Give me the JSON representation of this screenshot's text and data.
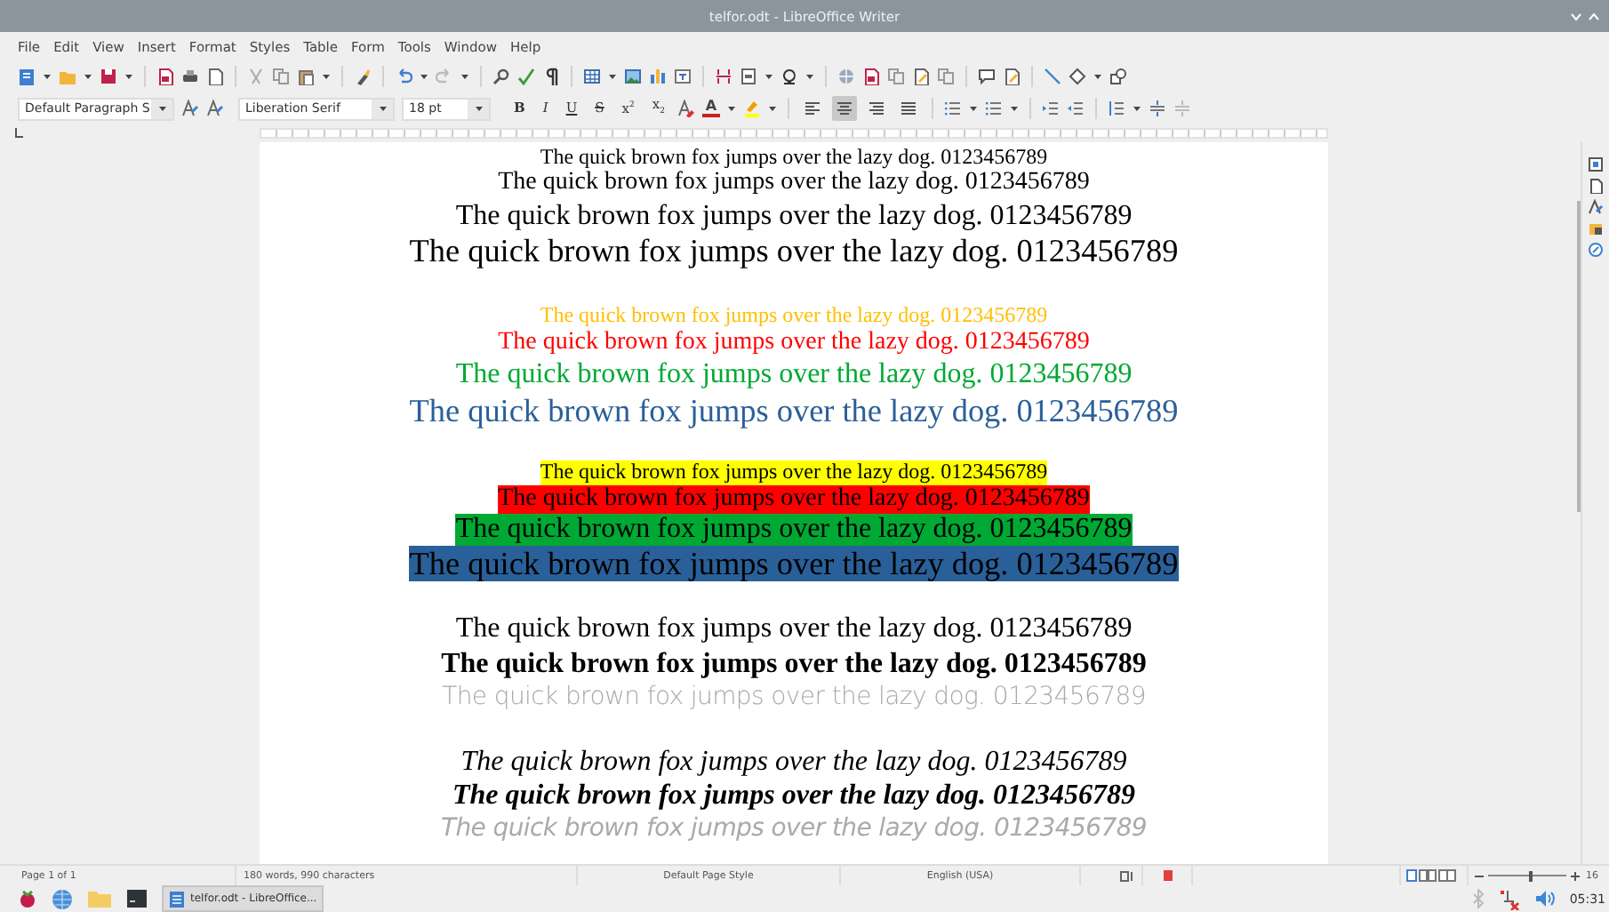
{
  "window": {
    "title": "telfor.odt - LibreOffice Writer"
  },
  "menu": [
    "File",
    "Edit",
    "View",
    "Insert",
    "Format",
    "Styles",
    "Table",
    "Form",
    "Tools",
    "Window",
    "Help"
  ],
  "formatting": {
    "paragraph_style": "Default Paragraph S",
    "font_name": "Liberation Serif",
    "font_size": "18 pt",
    "text_buttons": [
      {
        "label": "B",
        "kind": "bold"
      },
      {
        "label": "I",
        "kind": "italic"
      },
      {
        "label": "U",
        "kind": "underline"
      },
      {
        "label": "S",
        "kind": "strike"
      },
      {
        "label": "x$^{2}$",
        "kind": "plain"
      },
      {
        "label": "x$_{2}$",
        "kind": "plain"
      }
    ],
    "color_buttons": [
      {
        "label": "A",
        "color": "#c9211e"
      }
    ],
    "alignment": [
      {
        "selected": false
      },
      {
        "selected": true
      },
      {
        "selected": false
      },
      {
        "selected": false
      }
    ]
  },
  "document": {
    "groups": [
      {
        "kind": "sizes",
        "lines": [
          {
            "text": "The quick brown fox jumps over the lazy dog. 0123456789"
          },
          {
            "text": "The quick brown fox jumps over the lazy dog. 0123456789"
          },
          {
            "text": "The quick brown fox jumps over the lazy dog. 0123456789"
          },
          {
            "text": "The quick brown fox jumps over the lazy dog. 0123456789"
          }
        ]
      },
      {
        "kind": "colors",
        "lines": [
          {
            "text": "The quick brown fox jumps over the lazy dog. 0123456789",
            "color": "#ffbf00"
          },
          {
            "text": "The quick brown fox jumps over the lazy dog. 0123456789",
            "color": "#ff0000"
          },
          {
            "text": "The quick brown fox jumps over the lazy dog. 0123456789",
            "color": "#00a933"
          },
          {
            "text": "The quick brown fox jumps over the lazy dog. 0123456789",
            "color": "#2a6099"
          }
        ]
      },
      {
        "kind": "highlights",
        "lines": [
          {
            "text": "The quick brown fox jumps over the lazy dog. 0123456789",
            "color": "#ffff00"
          },
          {
            "text": "The quick brown fox jumps over the lazy dog. 0123456789",
            "color": "#ff0000"
          },
          {
            "text": "The quick brown fox jumps over the lazy dog. 0123456789",
            "color": "#00a933"
          },
          {
            "text": "The quick brown fox jumps over the lazy dog. 0123456789",
            "color": "#2a6099"
          }
        ]
      },
      {
        "kind": "styles",
        "lines": [
          {
            "text": "The quick brown fox jumps over the lazy dog. 0123456789",
            "kind": "regular"
          },
          {
            "text": "The quick brown fox jumps over the lazy dog. 0123456789",
            "kind": "bold"
          },
          {
            "text": "The quick brown fox jumps over the lazy dog. 0123456789",
            "kind": "light"
          }
        ]
      },
      {
        "kind": "styles",
        "lines": [
          {
            "text": "The quick brown fox jumps over the lazy dog. 0123456789",
            "kind": "italic"
          },
          {
            "text": "The quick brown fox jumps over the lazy dog. 0123456789",
            "kind": "bold-italic"
          },
          {
            "text": "The quick brown fox jumps over the lazy dog. 0123456789",
            "kind": "light-italic"
          }
        ]
      }
    ]
  },
  "status_bar": {
    "page": "Page 1 of 1",
    "counts": "180 words, 990 characters",
    "page_style": "Default Page Style",
    "language": "English (USA)",
    "level": 0.55,
    "zoom": "16"
  },
  "taskbar": {
    "windows": [
      {
        "label": "telfor.odt - LibreOffice...",
        "selected": true
      }
    ],
    "clock": "05:31"
  }
}
